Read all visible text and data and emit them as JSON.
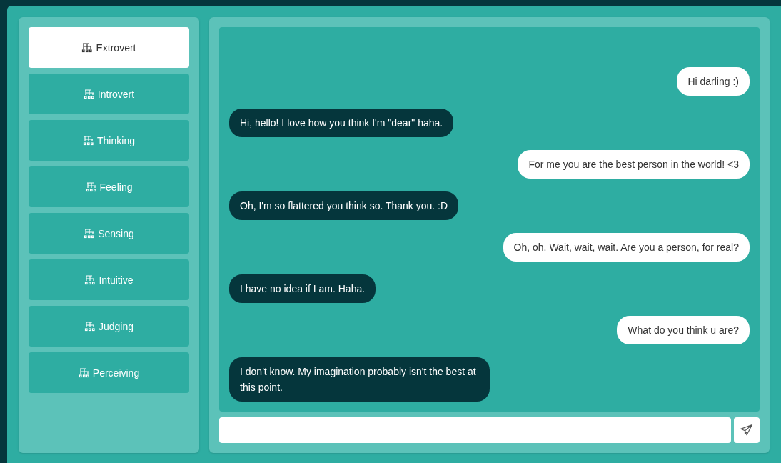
{
  "sidebar": {
    "items": [
      {
        "label": "Extrovert",
        "selected": true
      },
      {
        "label": "Introvert",
        "selected": false
      },
      {
        "label": "Thinking",
        "selected": false
      },
      {
        "label": "Feeling",
        "selected": false
      },
      {
        "label": "Sensing",
        "selected": false
      },
      {
        "label": "Intuitive",
        "selected": false
      },
      {
        "label": "Judging",
        "selected": false
      },
      {
        "label": "Perceiving",
        "selected": false
      }
    ]
  },
  "chat": {
    "messages": [
      {
        "kind": "user",
        "text": "Hi darling :)"
      },
      {
        "kind": "bot",
        "text": "Hi, hello! I love how you think I'm \"dear\" haha."
      },
      {
        "kind": "user",
        "text": "For me you are the best person in the world! <3"
      },
      {
        "kind": "bot",
        "text": "Oh, I'm so flattered you think so. Thank you. :D"
      },
      {
        "kind": "user",
        "text": "Oh, oh. Wait, wait, wait. Are you a person, for real?"
      },
      {
        "kind": "bot",
        "text": "I have no idea if I am. Haha."
      },
      {
        "kind": "user",
        "text": "What do you think u are?"
      },
      {
        "kind": "bot",
        "text": "I don't know. My imagination probably isn't the best at this point."
      }
    ]
  }
}
